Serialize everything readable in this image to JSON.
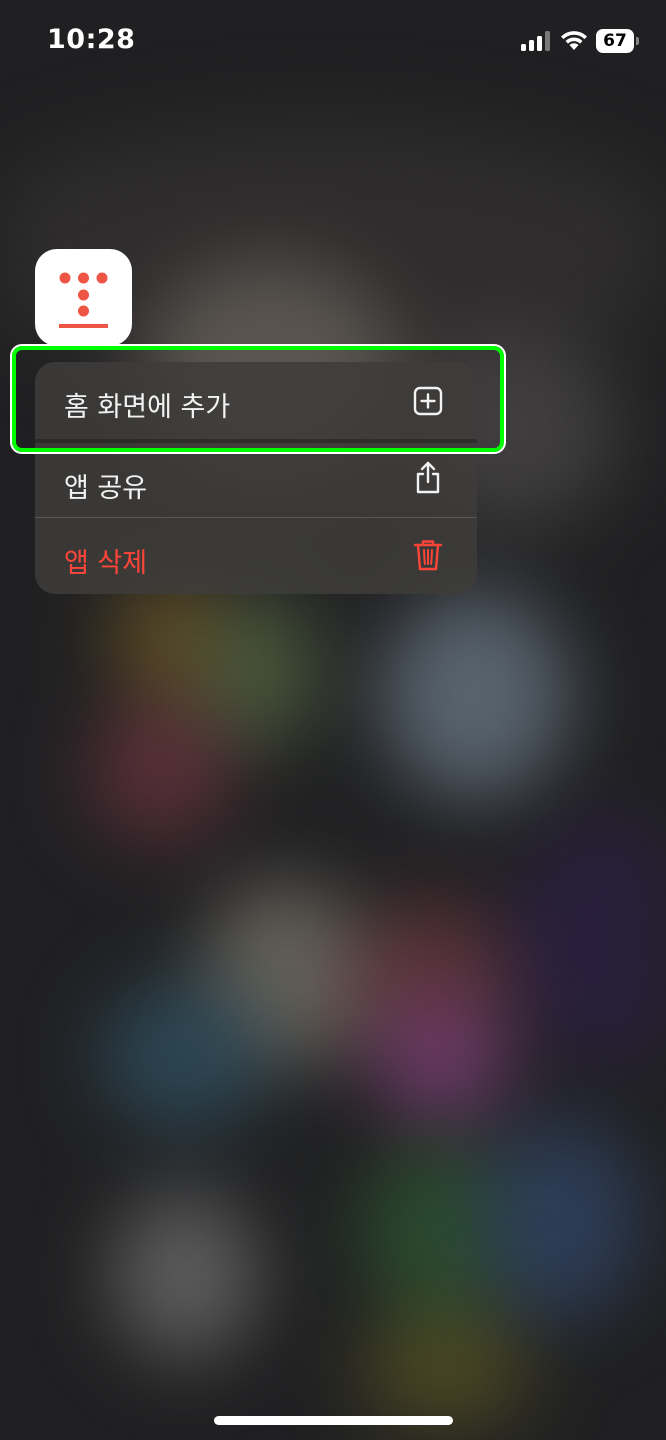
{
  "status_bar": {
    "time": "10:28",
    "battery_level": "67"
  },
  "app": {
    "icon_name": "dot-matrix-app-icon",
    "icon_color": "#ef5545"
  },
  "context_menu": {
    "items": [
      {
        "label": "홈 화면에 추가",
        "icon": "add-square-icon",
        "highlighted": true
      },
      {
        "label": "앱 공유",
        "icon": "share-icon",
        "highlighted": false
      },
      {
        "label": "앱 삭제",
        "icon": "trash-icon",
        "destructive": true,
        "color": "#ff453a"
      }
    ]
  },
  "highlight_color": "#00ff00"
}
